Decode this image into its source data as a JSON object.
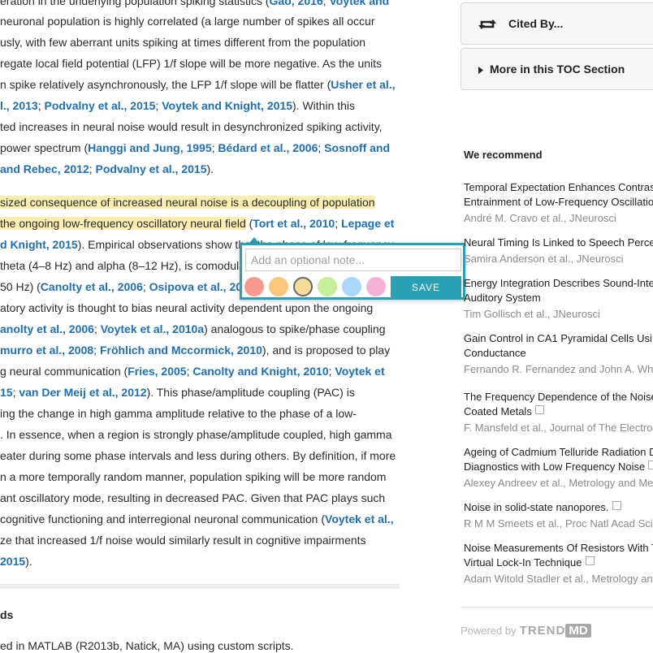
{
  "article": {
    "lines": [
      [
        {
          "t": "eration in the underlying population spiking statistics ("
        },
        {
          "t": "Gao, 2016",
          "r": 1
        },
        {
          "t": "; "
        },
        {
          "t": "Voytek and",
          "r": 1
        }
      ],
      [
        {
          "t": "neuronal population is highly correlated (a large number of spikes all occur"
        }
      ],
      [
        {
          "t": "usly, with few aberrant units spiking at times different from the population"
        }
      ],
      [
        {
          "t": "regate local field potential (LFP) 1/f slope will be more negative. As the units"
        }
      ],
      [
        {
          "t": "n spike relatively asynchronously, the LFP 1/f slope will be flatter ("
        },
        {
          "t": "Usher et al.,",
          "r": 1
        }
      ],
      [
        {
          "t": "l., 2013",
          "r": 1
        },
        {
          "t": "; "
        },
        {
          "t": "Podvalny et al., 2015",
          "r": 1
        },
        {
          "t": "; "
        },
        {
          "t": "Voytek and Knight, 2015",
          "r": 1
        },
        {
          "t": "). Within this"
        }
      ],
      [
        {
          "t": "ted increases in neural noise would result in desynchronized spiking activity,"
        }
      ],
      [
        {
          "t": " power spectrum ("
        },
        {
          "t": "Hanggi and Jung, 1995",
          "r": 1
        },
        {
          "t": "; "
        },
        {
          "t": "Bédard et al., 2006",
          "r": 1
        },
        {
          "t": "; "
        },
        {
          "t": "Sosnoff and",
          "r": 1
        }
      ],
      [
        {
          "t": " and Rebec, 2012",
          "r": 1
        },
        {
          "t": "; "
        },
        {
          "t": "Podvalny et al., 2015",
          "r": 1
        },
        {
          "t": ")."
        }
      ],
      [],
      [
        {
          "t": "sized consequence of increased neural noise is a decoupling of population",
          "h": 1
        }
      ],
      [
        {
          "t": "the ongoing low-frequency oscillatory neural field",
          "h": 1
        },
        {
          "t": " ("
        },
        {
          "t": "Tort et al., 2010",
          "r": 1
        },
        {
          "t": "; "
        },
        {
          "t": "Lepage et",
          "r": 1
        }
      ],
      [
        {
          "t": "d Knight, 2015",
          "r": 1
        },
        {
          "t": "). Empirical observations show that the phase of low-frequency"
        }
      ],
      [
        {
          "t": " theta (4–8 Hz) and alpha (8–12 Hz), is comodula"
        }
      ],
      [
        {
          "t": "50 Hz) ("
        },
        {
          "t": "Canolty et al., 2006",
          "r": 1
        },
        {
          "t": "; "
        },
        {
          "t": "Osipova et al., 20",
          "r": 1
        }
      ],
      [
        {
          "t": "atory activity is thought to bias neural activity dependent upon the ongoing"
        }
      ],
      [
        {
          "t": "anolty et al., 2006",
          "r": 1
        },
        {
          "t": "; "
        },
        {
          "t": "Voytek et al., 2010a",
          "r": 1
        },
        {
          "t": ") analogous to spike/phase coupling"
        }
      ],
      [
        {
          "t": "murro et al., 2008",
          "r": 1
        },
        {
          "t": "; "
        },
        {
          "t": "Fröhlich and Mccormick, 2010",
          "r": 1
        },
        {
          "t": "), and is proposed to play"
        }
      ],
      [
        {
          "t": "g neural communication ("
        },
        {
          "t": "Fries, 2005",
          "r": 1
        },
        {
          "t": "; "
        },
        {
          "t": "Canolty and Knight, 2010",
          "r": 1
        },
        {
          "t": "; "
        },
        {
          "t": "Voytek et",
          "r": 1
        }
      ],
      [
        {
          "t": "15",
          "r": 1
        },
        {
          "t": "; "
        },
        {
          "t": "van Der Meij et al., 2012",
          "r": 1
        },
        {
          "t": "). This phase/amplitude coupling (PAC) is"
        }
      ],
      [
        {
          "t": "ing the change in high gamma amplitude relative to the phase of a low-"
        }
      ],
      [
        {
          "t": ". In essence, when a region is strongly phase/amplitude coupled, high gamma"
        }
      ],
      [
        {
          "t": "eater during some phase intervals and less during others. By definition, if more"
        }
      ],
      [
        {
          "t": "n a more temporally random manner, population spiking will be more random"
        }
      ],
      [
        {
          "t": "ant oscillatory mode, resulting in decreased PAC. Given that PAC plays such"
        }
      ],
      [
        {
          "t": "cognitive functioning and interregional neuronal communication ("
        },
        {
          "t": "Voytek et al.,",
          "r": 1
        }
      ],
      [
        {
          "t": "ze that increased 1/f noise would similarly result in cognitive impairments"
        }
      ],
      [
        {
          "t": " 2015",
          "r": 1
        },
        {
          "t": ")."
        }
      ]
    ],
    "section_heading": "ds",
    "methods_line": "ed in MATLAB (R2013b, Natick, MA) using custom scripts."
  },
  "note_popup": {
    "placeholder": "Add an optional note...",
    "save_label": "SAVE",
    "colors": [
      "#f69a90",
      "#fcc57c",
      "#f6dc9a",
      "#c7ee99",
      "#a9d8f9",
      "#f6b2d6"
    ],
    "selected_color_index": 2
  },
  "sidebar": {
    "cited_by": {
      "label": "Cited By...",
      "icon": "retweet-icon"
    },
    "more_toc": {
      "label": "More in this TOC Section",
      "icon": "triangle-right-icon"
    },
    "recommend_heading": "We recommend",
    "recommendations": [
      {
        "title_lines": [
          "Temporal Expectation Enhances Contras",
          "Entrainment of Low-Frequency Oscillatio"
        ],
        "authors": "André M. Cravo et al., JNeurosci",
        "external": false
      },
      {
        "title_lines": [
          "Neural Timing Is Linked to Speech Perce"
        ],
        "authors": "Samira Anderson et al., JNeurosci",
        "external": false
      },
      {
        "title_lines": [
          "Energy Integration Describes Sound-Inte",
          "Auditory System"
        ],
        "authors": "Tim Gollisch et al., JNeurosci",
        "external": false
      },
      {
        "title_lines": [
          "Gain Control in CA1 Pyramidal Cells Usi",
          "Conductance"
        ],
        "authors": "Fernando R. Fernandez and John A. Wh",
        "external": false
      },
      {
        "title_lines": [
          "The Frequency Dependence of the Noise",
          "Coated Metals"
        ],
        "authors": "F. Mansfeld et al., Journal of The Electro",
        "external": true
      },
      {
        "title_lines": [
          "Ageing of Cadmium Telluride Radiation D",
          "Diagnostics with Low Frequency Noise"
        ],
        "authors": "Alexey Andreev et al., Metrology and Me",
        "external": true
      },
      {
        "title_lines": [
          "Noise in solid-state nanopores."
        ],
        "authors": "R M M Smeets et al., Proc Natl Acad Sci",
        "external": true
      },
      {
        "title_lines": [
          "Noise Measurements Of Resistors With T",
          "Virtual Lock-In Technique"
        ],
        "authors": "Adam Witold Stadler et al., Metrology an",
        "external": true
      }
    ],
    "powered_by": "Powered by",
    "brand_a": "TREND",
    "brand_b": "MD"
  }
}
